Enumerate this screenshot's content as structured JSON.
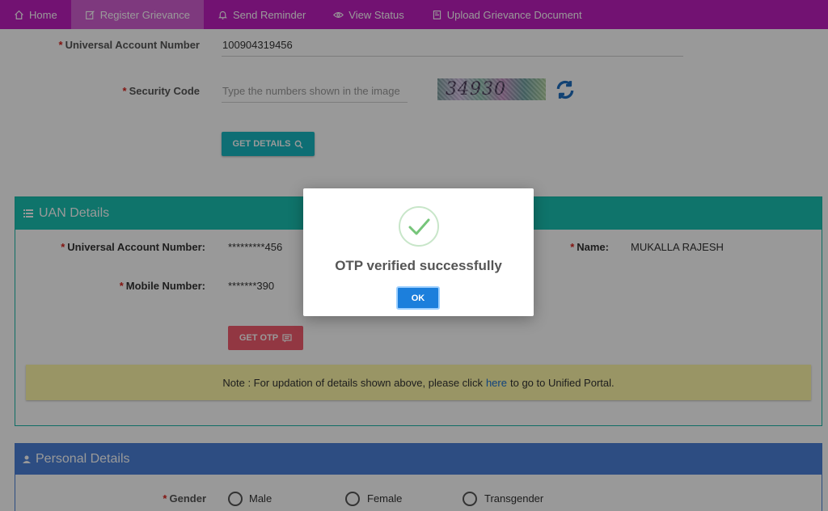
{
  "nav": {
    "items": [
      {
        "label": "Home",
        "icon": "home-icon"
      },
      {
        "label": "Register Grievance",
        "icon": "edit-icon",
        "active": true
      },
      {
        "label": "Send Reminder",
        "icon": "bell-icon"
      },
      {
        "label": "View Status",
        "icon": "eye-icon"
      },
      {
        "label": "Upload Grievance Document",
        "icon": "document-icon"
      }
    ]
  },
  "search_form": {
    "uan_label": "Universal Account Number",
    "uan_value": "100904319456",
    "security_label": "Security Code",
    "security_placeholder": "Type the numbers shown in the image",
    "captcha_text": "34930",
    "get_details_label": "GET DETAILS"
  },
  "uan_details": {
    "title": "UAN Details",
    "uan_label": "Universal Account Number:",
    "uan_value": "*********456",
    "name_label": "Name:",
    "name_value": "MUKALLA RAJESH",
    "mobile_label": "Mobile Number:",
    "mobile_value": "*******390",
    "get_otp_label": "GET OTP",
    "note_prefix": "Note : For updation of details shown above, please click",
    "note_link": "here",
    "note_suffix": "to go to Unified Portal."
  },
  "personal_details": {
    "title": "Personal Details",
    "gender_label": "Gender",
    "gender_options": [
      "Male",
      "Female",
      "Transgender"
    ]
  },
  "modal": {
    "message": "OTP verified successfully",
    "ok_label": "OK"
  },
  "colors": {
    "nav": "#bf1fbf",
    "uan_header": "#19c2b2",
    "personal_header": "#4c80d9",
    "get_details": "#18b8c2",
    "get_otp": "#f45c6e",
    "ok": "#1c7fdc"
  }
}
